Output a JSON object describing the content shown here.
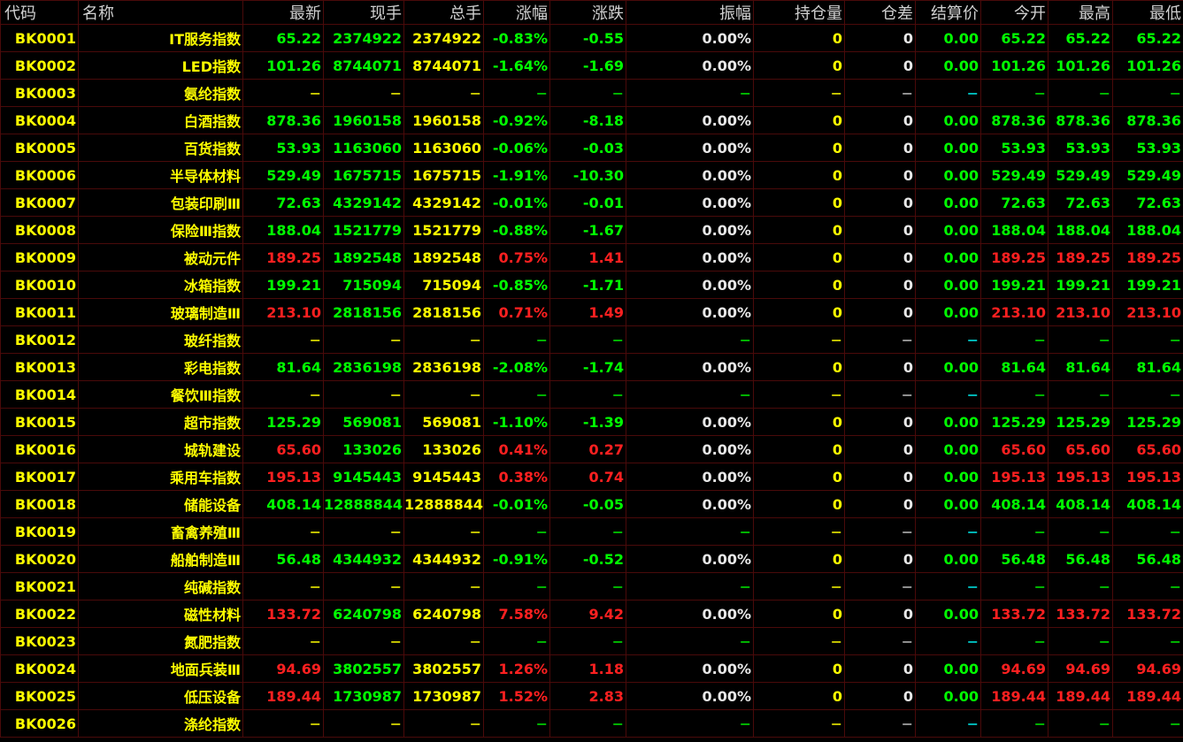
{
  "headers": [
    "代码",
    "名称",
    "最新",
    "现手",
    "总手",
    "涨幅",
    "涨跌",
    "振幅",
    "持仓量",
    "仓差",
    "结算价",
    "今开",
    "最高",
    "最低"
  ],
  "rows": [
    [
      "BK0001",
      "IT服务指数",
      "65.22",
      "2374922",
      "2374922",
      "-0.83%",
      "-0.55",
      "0.00%",
      "0",
      "0",
      "0.00",
      "65.22",
      "65.22",
      "65.22"
    ],
    [
      "BK0002",
      "LED指数",
      "101.26",
      "8744071",
      "8744071",
      "-1.64%",
      "-1.69",
      "0.00%",
      "0",
      "0",
      "0.00",
      "101.26",
      "101.26",
      "101.26"
    ],
    [
      "BK0003",
      "氨纶指数",
      "−",
      "−",
      "−",
      "−",
      "−",
      "−",
      "−",
      "−",
      "−",
      "−",
      "−",
      "−"
    ],
    [
      "BK0004",
      "白酒指数",
      "878.36",
      "1960158",
      "1960158",
      "-0.92%",
      "-8.18",
      "0.00%",
      "0",
      "0",
      "0.00",
      "878.36",
      "878.36",
      "878.36"
    ],
    [
      "BK0005",
      "百货指数",
      "53.93",
      "1163060",
      "1163060",
      "-0.06%",
      "-0.03",
      "0.00%",
      "0",
      "0",
      "0.00",
      "53.93",
      "53.93",
      "53.93"
    ],
    [
      "BK0006",
      "半导体材料",
      "529.49",
      "1675715",
      "1675715",
      "-1.91%",
      "-10.30",
      "0.00%",
      "0",
      "0",
      "0.00",
      "529.49",
      "529.49",
      "529.49"
    ],
    [
      "BK0007",
      "包装印刷Ⅲ",
      "72.63",
      "4329142",
      "4329142",
      "-0.01%",
      "-0.01",
      "0.00%",
      "0",
      "0",
      "0.00",
      "72.63",
      "72.63",
      "72.63"
    ],
    [
      "BK0008",
      "保险Ⅲ指数",
      "188.04",
      "1521779",
      "1521779",
      "-0.88%",
      "-1.67",
      "0.00%",
      "0",
      "0",
      "0.00",
      "188.04",
      "188.04",
      "188.04"
    ],
    [
      "BK0009",
      "被动元件",
      "189.25",
      "1892548",
      "1892548",
      "0.75%",
      "1.41",
      "0.00%",
      "0",
      "0",
      "0.00",
      "189.25",
      "189.25",
      "189.25"
    ],
    [
      "BK0010",
      "冰箱指数",
      "199.21",
      "715094",
      "715094",
      "-0.85%",
      "-1.71",
      "0.00%",
      "0",
      "0",
      "0.00",
      "199.21",
      "199.21",
      "199.21"
    ],
    [
      "BK0011",
      "玻璃制造Ⅲ",
      "213.10",
      "2818156",
      "2818156",
      "0.71%",
      "1.49",
      "0.00%",
      "0",
      "0",
      "0.00",
      "213.10",
      "213.10",
      "213.10"
    ],
    [
      "BK0012",
      "玻纤指数",
      "−",
      "−",
      "−",
      "−",
      "−",
      "−",
      "−",
      "−",
      "−",
      "−",
      "−",
      "−"
    ],
    [
      "BK0013",
      "彩电指数",
      "81.64",
      "2836198",
      "2836198",
      "-2.08%",
      "-1.74",
      "0.00%",
      "0",
      "0",
      "0.00",
      "81.64",
      "81.64",
      "81.64"
    ],
    [
      "BK0014",
      "餐饮Ⅲ指数",
      "−",
      "−",
      "−",
      "−",
      "−",
      "−",
      "−",
      "−",
      "−",
      "−",
      "−",
      "−"
    ],
    [
      "BK0015",
      "超市指数",
      "125.29",
      "569081",
      "569081",
      "-1.10%",
      "-1.39",
      "0.00%",
      "0",
      "0",
      "0.00",
      "125.29",
      "125.29",
      "125.29"
    ],
    [
      "BK0016",
      "城轨建设",
      "65.60",
      "133026",
      "133026",
      "0.41%",
      "0.27",
      "0.00%",
      "0",
      "0",
      "0.00",
      "65.60",
      "65.60",
      "65.60"
    ],
    [
      "BK0017",
      "乘用车指数",
      "195.13",
      "9145443",
      "9145443",
      "0.38%",
      "0.74",
      "0.00%",
      "0",
      "0",
      "0.00",
      "195.13",
      "195.13",
      "195.13"
    ],
    [
      "BK0018",
      "储能设备",
      "408.14",
      "12888844",
      "12888844",
      "-0.01%",
      "-0.05",
      "0.00%",
      "0",
      "0",
      "0.00",
      "408.14",
      "408.14",
      "408.14"
    ],
    [
      "BK0019",
      "畜禽养殖Ⅲ",
      "−",
      "−",
      "−",
      "−",
      "−",
      "−",
      "−",
      "−",
      "−",
      "−",
      "−",
      "−"
    ],
    [
      "BK0020",
      "船舶制造Ⅲ",
      "56.48",
      "4344932",
      "4344932",
      "-0.91%",
      "-0.52",
      "0.00%",
      "0",
      "0",
      "0.00",
      "56.48",
      "56.48",
      "56.48"
    ],
    [
      "BK0021",
      "纯碱指数",
      "−",
      "−",
      "−",
      "−",
      "−",
      "−",
      "−",
      "−",
      "−",
      "−",
      "−",
      "−"
    ],
    [
      "BK0022",
      "磁性材料",
      "133.72",
      "6240798",
      "6240798",
      "7.58%",
      "9.42",
      "0.00%",
      "0",
      "0",
      "0.00",
      "133.72",
      "133.72",
      "133.72"
    ],
    [
      "BK0023",
      "氮肥指数",
      "−",
      "−",
      "−",
      "−",
      "−",
      "−",
      "−",
      "−",
      "−",
      "−",
      "−",
      "−"
    ],
    [
      "BK0024",
      "地面兵装Ⅲ",
      "94.69",
      "3802557",
      "3802557",
      "1.26%",
      "1.18",
      "0.00%",
      "0",
      "0",
      "0.00",
      "94.69",
      "94.69",
      "94.69"
    ],
    [
      "BK0025",
      "低压设备",
      "189.44",
      "1730987",
      "1730987",
      "1.52%",
      "2.83",
      "0.00%",
      "0",
      "0",
      "0.00",
      "189.44",
      "189.44",
      "189.44"
    ],
    [
      "BK0026",
      "涤纶指数",
      "−",
      "−",
      "−",
      "−",
      "−",
      "−",
      "−",
      "−",
      "−",
      "−",
      "−",
      "−"
    ]
  ],
  "colors": {
    "up": "#ff2020",
    "down": "#00ff00",
    "code": "#ffff00",
    "neutral": "#e8e8e8",
    "grid": "#4a0a0a",
    "background": "#000000"
  }
}
